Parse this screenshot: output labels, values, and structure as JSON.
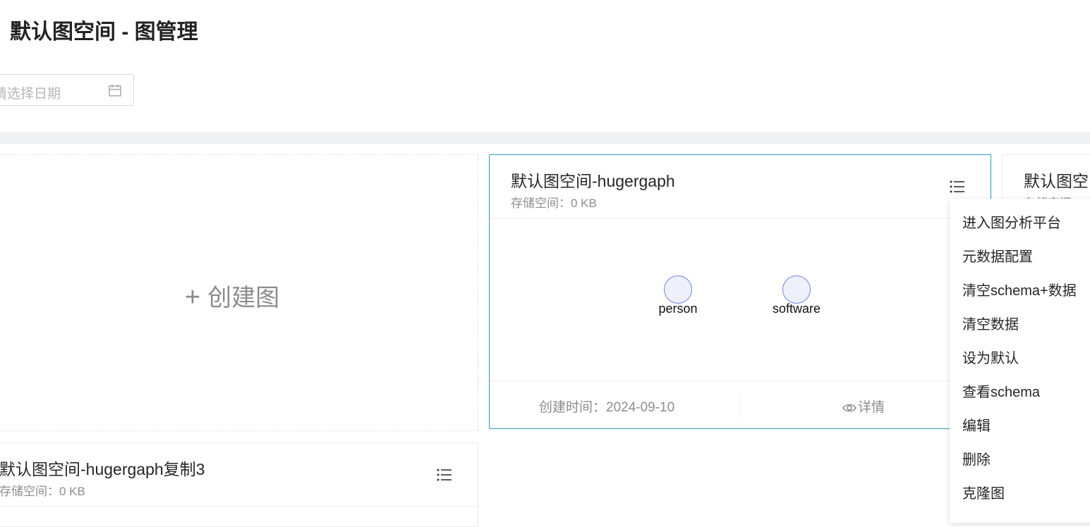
{
  "page": {
    "title": "默认图空间 - 图管理"
  },
  "filter": {
    "date_placeholder": "请选择日期",
    "icon": "calendar-icon"
  },
  "create_card": {
    "label": "创建图",
    "icon": "plus-icon"
  },
  "graphs": [
    {
      "title": "默认图空间-hugergaph",
      "storage": "存储空间：0 KB",
      "nodes": [
        "person",
        "software"
      ],
      "created": "创建时间：2024-09-10",
      "detail_label": "详情"
    },
    {
      "title": "默认图空",
      "storage": "存储空间：0 KB"
    },
    {
      "title": "默认图空间-hugergaph复制3",
      "storage": "存储空间：0 KB"
    }
  ],
  "menu": {
    "items": [
      "进入图分析平台",
      "元数据配置",
      "清空schema+数据",
      "清空数据",
      "设为默认",
      "查看schema",
      "编辑",
      "删除",
      "克隆图"
    ]
  },
  "colors": {
    "accent_border": "#2a9bb7",
    "node_stroke": "#6f84e6",
    "node_fill": "#eef0fb"
  }
}
